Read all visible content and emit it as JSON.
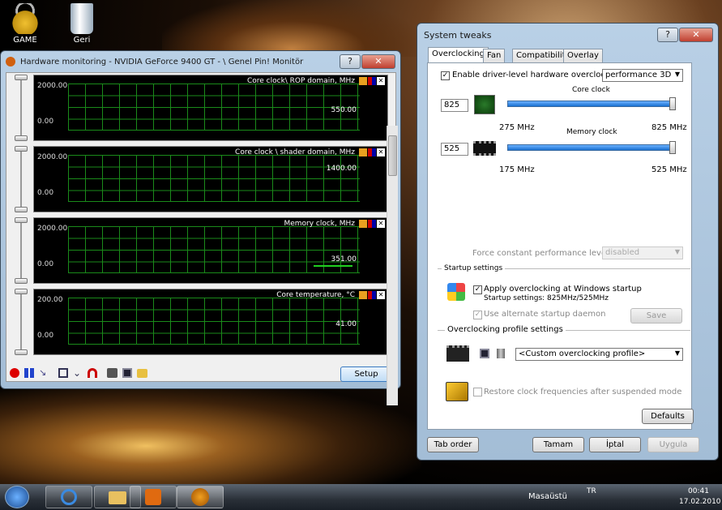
{
  "desktop": {
    "icons": [
      {
        "label": "GAME"
      },
      {
        "label": "Geri"
      }
    ]
  },
  "monitor": {
    "title": "Hardware monitoring - NVIDIA GeForce 9400 GT - \\ Genel Pin! Monitör",
    "graphs": [
      {
        "title": "Core clock\\ ROP domain, MHz",
        "ymax": "2000.00",
        "ymin": "0.00",
        "current": "550.00"
      },
      {
        "title": "Core clock \\ shader domain, MHz",
        "ymax": "2000.00",
        "ymin": "0.00",
        "current": "1400.00"
      },
      {
        "title": "Memory clock, MHz",
        "ymax": "2000.00",
        "ymin": "0.00",
        "current": "351.00"
      },
      {
        "title": "Core temperature, °C",
        "ymax": "200.00",
        "ymin": "0.00",
        "current": "41.00"
      }
    ],
    "setup_label": "Setup"
  },
  "tweaks": {
    "title": "System tweaks",
    "help": "?",
    "tabs": [
      "Overclocking",
      "Fan",
      "Compatibility",
      "Overlay"
    ],
    "enable_label": "Enable driver-level hardware overclocking",
    "mode": "performance 3D",
    "core": {
      "title": "Core clock",
      "value": "825",
      "min": "275 MHz",
      "max": "825 MHz",
      "fraction": 1.0
    },
    "mem": {
      "title": "Memory clock",
      "value": "525",
      "min": "175 MHz",
      "max": "525 MHz",
      "fraction": 1.0
    },
    "force_label": "Force constant performance leve",
    "force_value": "disabled",
    "startup_group": "Startup settings",
    "apply_label": "Apply overclocking at Windows startup",
    "startup_detail": "Startup settings: 825MHz/525MHz",
    "daemon_label": "Use alternate startup daemon",
    "save_label": "Save",
    "profile_group": "Overclocking profile settings",
    "profile_value": "<Custom overclocking profile>",
    "restore_label": "Restore clock frequencies after suspended mode",
    "defaults_label": "Defaults",
    "tab_order": "Tab order",
    "ok": "Tamam",
    "cancel": "İptal",
    "apply": "Uygula"
  },
  "taskbar": {
    "desktop_label": "Masaüstü",
    "lang": "TR",
    "time": "00:41",
    "date": "17.02.2010"
  },
  "chart_data": {
    "type": "line",
    "series": [
      {
        "name": "Memory clock, MHz",
        "values": [
          351
        ]
      }
    ]
  }
}
